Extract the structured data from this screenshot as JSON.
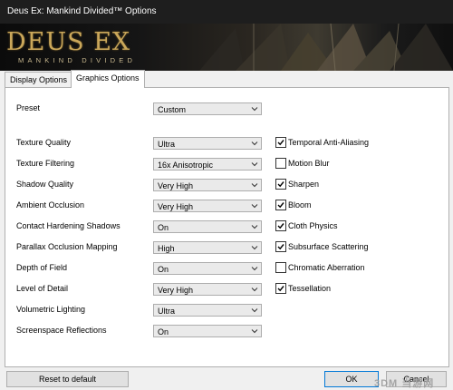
{
  "window": {
    "title": "Deus Ex: Mankind Divided™ Options"
  },
  "banner": {
    "logo_text": "DEUS EX",
    "subtitle": "MANKIND DIVIDED"
  },
  "tabs": [
    {
      "label": "Display Options",
      "active": false
    },
    {
      "label": "Graphics Options",
      "active": true
    }
  ],
  "settings": [
    {
      "label": "Preset",
      "value": "Custom"
    },
    {
      "label": "Texture Quality",
      "value": "Ultra"
    },
    {
      "label": "Texture Filtering",
      "value": "16x Anisotropic"
    },
    {
      "label": "Shadow Quality",
      "value": "Very High"
    },
    {
      "label": "Ambient Occlusion",
      "value": "Very High"
    },
    {
      "label": "Contact Hardening Shadows",
      "value": "On"
    },
    {
      "label": "Parallax Occlusion Mapping",
      "value": "High"
    },
    {
      "label": "Depth of Field",
      "value": "On"
    },
    {
      "label": "Level of Detail",
      "value": "Very High"
    },
    {
      "label": "Volumetric Lighting",
      "value": "Ultra"
    },
    {
      "label": "Screenspace Reflections",
      "value": "On"
    }
  ],
  "checkboxes": [
    {
      "label": "Temporal Anti-Aliasing",
      "checked": true
    },
    {
      "label": "Motion Blur",
      "checked": false
    },
    {
      "label": "Sharpen",
      "checked": true
    },
    {
      "label": "Bloom",
      "checked": true
    },
    {
      "label": "Cloth Physics",
      "checked": true
    },
    {
      "label": "Subsurface Scattering",
      "checked": true
    },
    {
      "label": "Chromatic Aberration",
      "checked": false
    },
    {
      "label": "Tessellation",
      "checked": true
    }
  ],
  "buttons": {
    "reset": "Reset to default",
    "ok": "OK",
    "cancel": "Cancel"
  },
  "watermark": "3DM 当游网",
  "colors": {
    "titlebar": "#1e1e1e",
    "accent": "#0078d7",
    "logo": "#caa75a"
  }
}
